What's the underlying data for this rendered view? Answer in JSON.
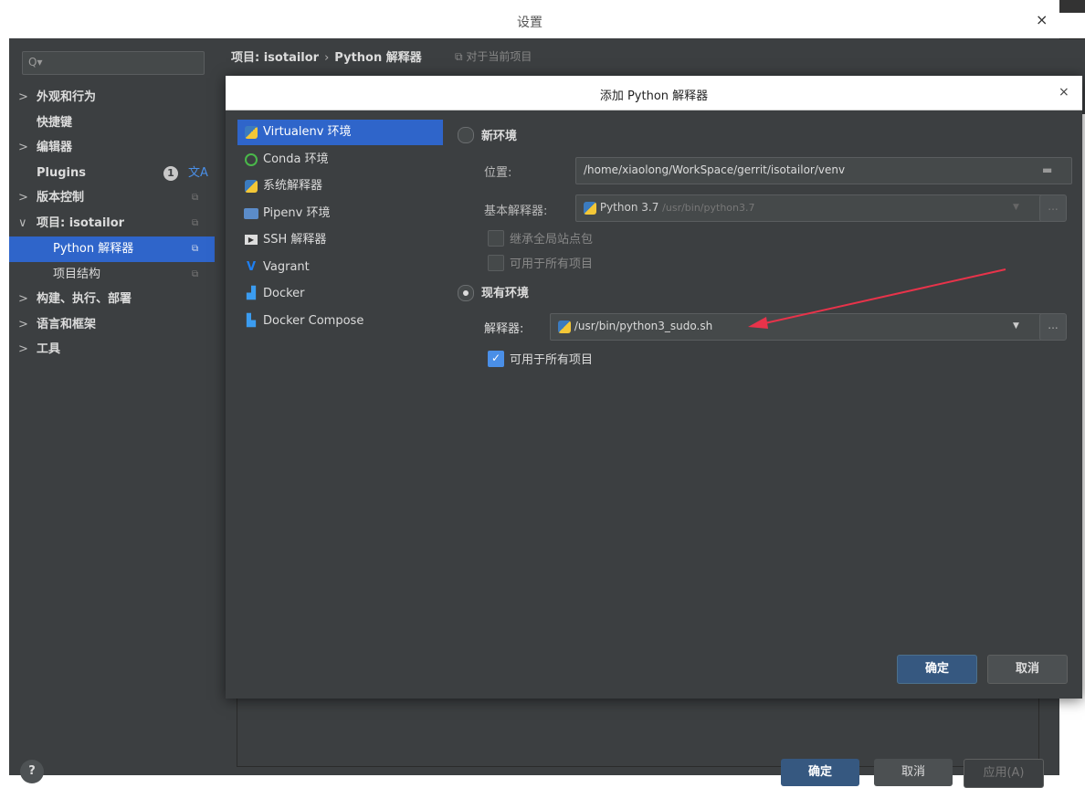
{
  "window": {
    "title": "设置",
    "close_glyph": "×"
  },
  "search": {
    "icon": "search-icon",
    "glyph": "Q▾"
  },
  "sidebar": {
    "items": [
      {
        "label": "外观和行为",
        "arrow": ">"
      },
      {
        "label": "快捷键",
        "arrow": ""
      },
      {
        "label": "编辑器",
        "arrow": ">"
      },
      {
        "label": "Plugins",
        "arrow": "",
        "badge": "1",
        "translate_glyph": "文A"
      },
      {
        "label": "版本控制",
        "arrow": ">"
      },
      {
        "label": "项目: isotailor",
        "arrow": "∨"
      },
      {
        "label": "Python 解释器",
        "arrow": ""
      },
      {
        "label": "项目结构",
        "arrow": ""
      },
      {
        "label": "构建、执行、部署",
        "arrow": ">"
      },
      {
        "label": "语言和框架",
        "arrow": ">"
      },
      {
        "label": "工具",
        "arrow": ">"
      }
    ],
    "copy_glyph": "⧉",
    "help": "?"
  },
  "breadcrumb": {
    "project": "项目: isotailor",
    "sep": "›",
    "page": "Python 解释器",
    "scope": "⧉ 对于当前项目"
  },
  "outer_buttons": {
    "ok": "确定",
    "cancel": "取消",
    "apply": "应用(A)"
  },
  "dialog": {
    "title": "添加 Python 解释器",
    "close_glyph": "×",
    "types": [
      {
        "label": "Virtualenv 环境",
        "icon": "python-virtualenv-icon"
      },
      {
        "label": "Conda 环境",
        "icon": "conda-icon"
      },
      {
        "label": "系统解释器",
        "icon": "python-icon"
      },
      {
        "label": "Pipenv 环境",
        "icon": "pipenv-icon"
      },
      {
        "label": "SSH 解释器",
        "icon": "ssh-icon"
      },
      {
        "label": "Vagrant",
        "icon": "vagrant-icon"
      },
      {
        "label": "Docker",
        "icon": "docker-icon"
      },
      {
        "label": "Docker Compose",
        "icon": "docker-compose-icon"
      }
    ],
    "new_env": {
      "label": "新环境",
      "location_label": "位置:",
      "location_value": "/home/xiaolong/WorkSpace/gerrit/isotailor/venv",
      "base_label": "基本解释器:",
      "base_value": "Python 3.7",
      "base_path": "/usr/bin/python3.7",
      "inherit_label": "继承全局站点包",
      "available_label": "可用于所有项目"
    },
    "existing_env": {
      "label": "现有环境",
      "interpreter_label": "解释器:",
      "interpreter_value": "/usr/bin/python3_sudo.sh",
      "available_label": "可用于所有项目",
      "available_checked": true
    },
    "browse_glyph": "...",
    "ok": "确定",
    "cancel": "取消",
    "annotation_color": "#e8334a"
  }
}
